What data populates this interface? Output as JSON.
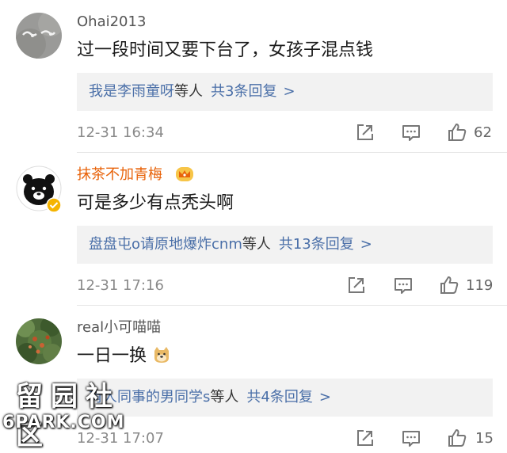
{
  "colors": {
    "link": "#4a6fa8",
    "vip_name": "#e8630a",
    "meta": "#8a8a8a",
    "reply_bg": "#f2f2f2"
  },
  "comments": [
    {
      "username": "Ohai2013",
      "text": "过一段时间又要下台了，女孩子混点钱",
      "reply_who": "我是李雨童呀",
      "reply_etc": "等人",
      "reply_count": "共3条回复",
      "reply_chevron": ">",
      "time": "12-31 16:34",
      "likes": "62",
      "icons": [
        "share-icon",
        "comment-icon",
        "like-icon"
      ]
    },
    {
      "username": "抹茶不加青梅",
      "text": "可是多少有点秃头啊",
      "reply_who": "盘盘屯o请原地爆炸cnm",
      "reply_etc": "等人",
      "reply_count": "共13条回复",
      "reply_chevron": ">",
      "time": "12-31 17:16",
      "likes": "119",
      "icons": [
        "crown-badge-icon",
        "verified-badge-icon",
        "share-icon",
        "comment-icon",
        "like-icon"
      ]
    },
    {
      "username": "real小可喵喵",
      "text": "一日一换",
      "reply_who": "有人同事的男同学s",
      "reply_etc": "等人",
      "reply_count": "共4条回复",
      "reply_chevron": ">",
      "time": "12-31 17:07",
      "likes": "15",
      "icons": [
        "doge-emoji-icon",
        "share-icon",
        "comment-icon",
        "like-icon"
      ]
    }
  ],
  "watermark": {
    "top": "留园社区",
    "bottom": "6PARK.COM"
  }
}
